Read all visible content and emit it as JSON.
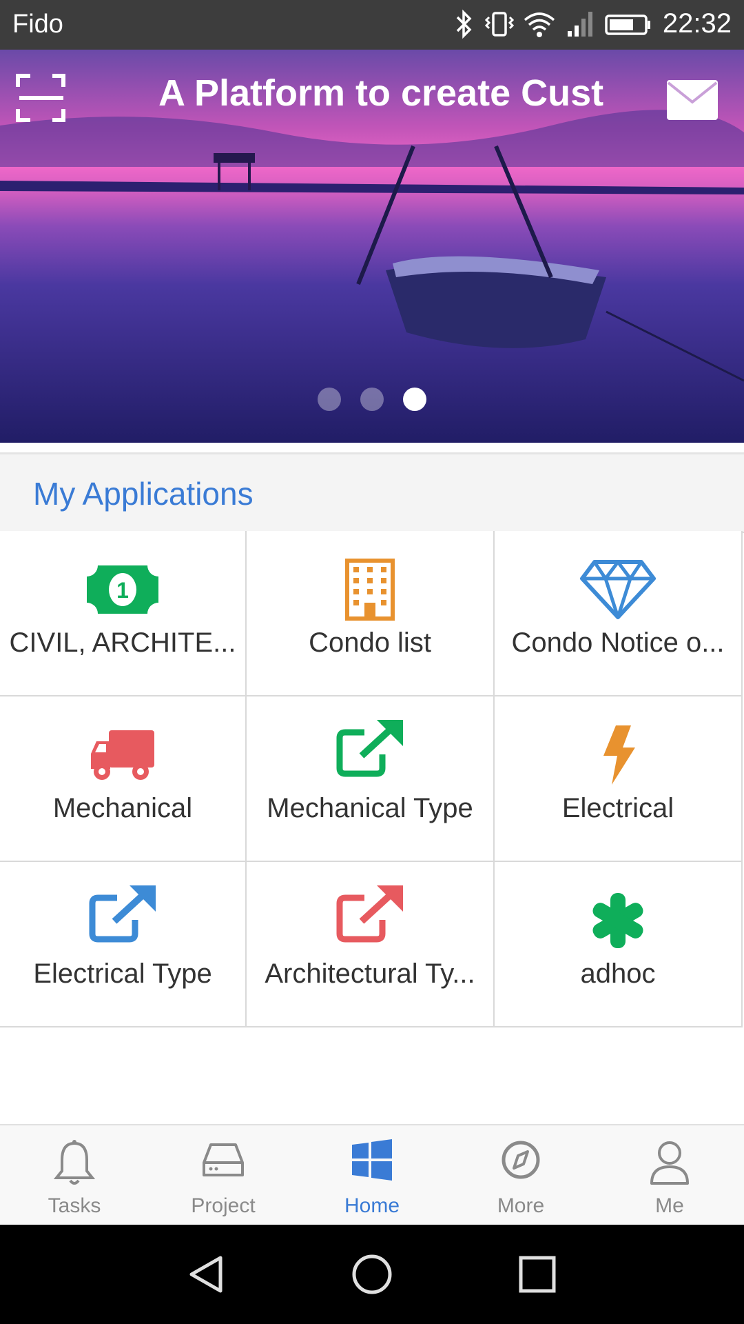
{
  "status_bar": {
    "carrier": "Fido",
    "time": "22:32"
  },
  "banner": {
    "title": "A Platform to create Cust",
    "scan_icon": "scan-icon",
    "mail_icon": "mail-icon",
    "slide_count": 3,
    "active_slide": 3
  },
  "section": {
    "title": "My Applications"
  },
  "apps": [
    {
      "label": "CIVIL, ARCHITE...",
      "icon": "money-icon",
      "color": "#0fae5a"
    },
    {
      "label": "Condo list",
      "icon": "building-icon",
      "color": "#e8922f"
    },
    {
      "label": "Condo Notice o...",
      "icon": "diamond-icon",
      "color": "#3d8bd6"
    },
    {
      "label": "Mechanical",
      "icon": "truck-icon",
      "color": "#e75a5f"
    },
    {
      "label": "Mechanical Type",
      "icon": "external-link-icon",
      "color": "#0fae5a"
    },
    {
      "label": "Electrical",
      "icon": "lightning-icon",
      "color": "#e8922f"
    },
    {
      "label": "Electrical Type",
      "icon": "external-link-icon",
      "color": "#3d8bd6"
    },
    {
      "label": "Architectural Ty...",
      "icon": "external-link-icon",
      "color": "#e75a5f"
    },
    {
      "label": "adhoc",
      "icon": "asterisk-icon",
      "color": "#0fae5a"
    }
  ],
  "bottom_nav": [
    {
      "label": "Tasks",
      "icon": "bell-icon",
      "active": false
    },
    {
      "label": "Project",
      "icon": "drive-icon",
      "active": false
    },
    {
      "label": "Home",
      "icon": "windows-icon",
      "active": true
    },
    {
      "label": "More",
      "icon": "compass-icon",
      "active": false
    },
    {
      "label": "Me",
      "icon": "user-icon",
      "active": false
    }
  ],
  "colors": {
    "accent": "#3a7bd5",
    "nav_inactive": "#8a8a8a"
  }
}
